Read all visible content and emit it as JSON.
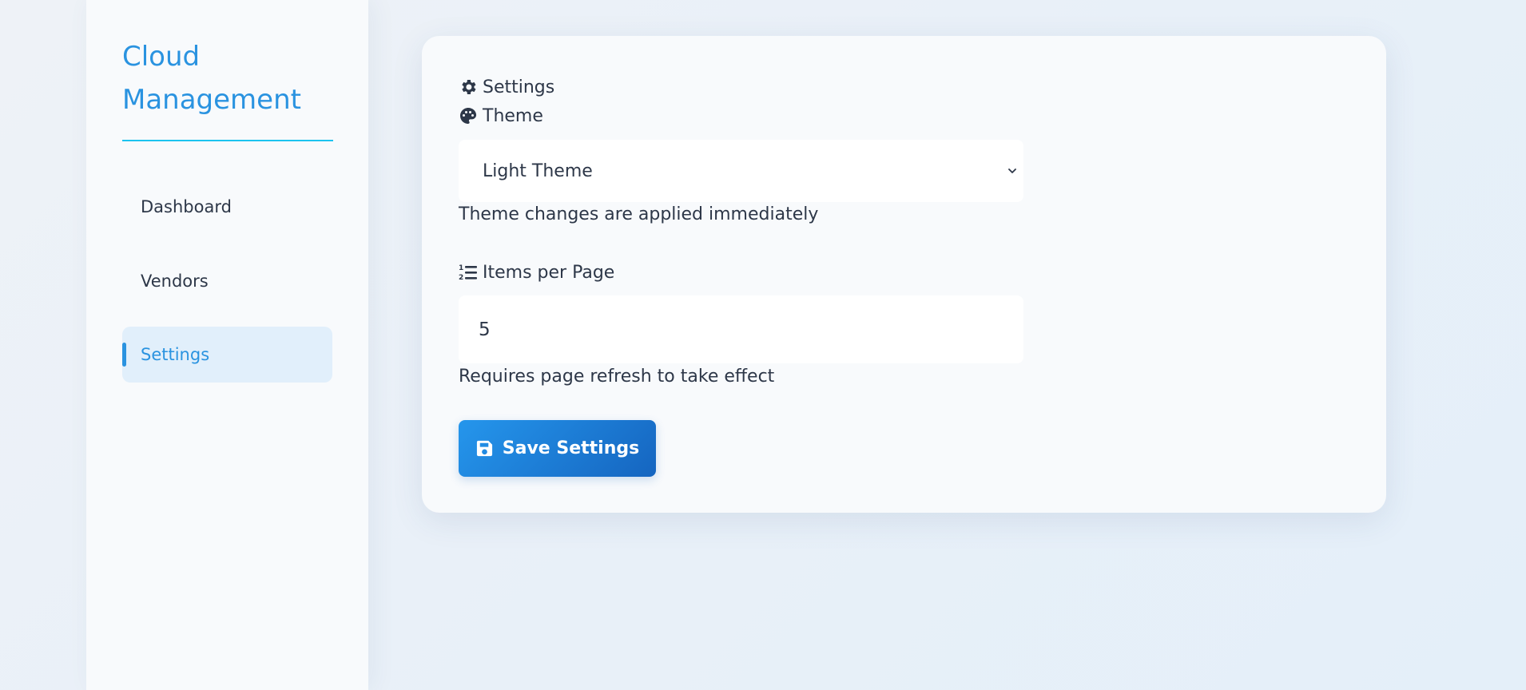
{
  "sidebar": {
    "brand_line1": "Cloud",
    "brand_line2": "Management",
    "items": [
      {
        "label": "Dashboard",
        "active": false
      },
      {
        "label": "Vendors",
        "active": false
      },
      {
        "label": "Settings",
        "active": true
      }
    ]
  },
  "settings": {
    "heading": "Settings",
    "heading_icon": "gear-icon",
    "theme": {
      "label": "Theme",
      "icon": "palette-icon",
      "selected": "Light Theme",
      "hint": "Theme changes are applied immediately"
    },
    "items_per_page": {
      "label": "Items per Page",
      "icon": "numbered-list-icon",
      "value": "5",
      "hint": "Requires page refresh to take effect"
    },
    "save_label": "Save Settings",
    "save_icon": "floppy-disk-icon"
  },
  "colors": {
    "accent": "#2a93e0",
    "brand_rule": "#1cc3ef",
    "active_nav_bg": "#e1effb",
    "button_start": "#2596ec",
    "button_end": "#1565c0",
    "text": "#2d3748"
  }
}
